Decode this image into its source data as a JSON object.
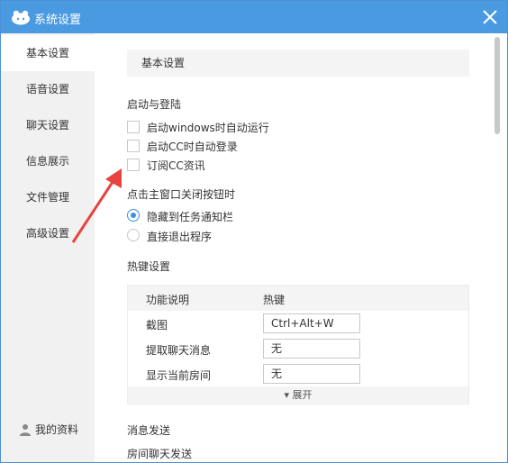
{
  "window": {
    "title": "系统设置",
    "accent": "#4a9ae2"
  },
  "sidebar": {
    "items": [
      {
        "label": "基本设置",
        "active": true
      },
      {
        "label": "语音设置"
      },
      {
        "label": "聊天设置"
      },
      {
        "label": "信息展示"
      },
      {
        "label": "文件管理"
      },
      {
        "label": "高级设置"
      }
    ],
    "profile": {
      "label": "我的资料",
      "icon": "user-icon"
    }
  },
  "main": {
    "section_title": "基本设置",
    "startup": {
      "title": "启动与登陆",
      "options": [
        {
          "label": "启动windows时自动运行",
          "checked": false
        },
        {
          "label": "启动CC时自动登录",
          "checked": false
        },
        {
          "label": "订阅CC资讯",
          "checked": false
        }
      ]
    },
    "close_behavior": {
      "title": "点击主窗口关闭按钮时",
      "options": [
        {
          "label": "隐藏到任务通知栏",
          "checked": true
        },
        {
          "label": "直接退出程序",
          "checked": false
        }
      ]
    },
    "hotkeys": {
      "title": "热键设置",
      "headers": {
        "function": "功能说明",
        "hotkey": "热键"
      },
      "rows": [
        {
          "function": "截图",
          "hotkey": "Ctrl+Alt+W"
        },
        {
          "function": "提取聊天消息",
          "hotkey": "无"
        },
        {
          "function": "显示当前房间",
          "hotkey": "无"
        }
      ],
      "expand_label": "展开"
    },
    "message": {
      "title": "消息发送",
      "partial_label": "房间聊天发送"
    }
  }
}
